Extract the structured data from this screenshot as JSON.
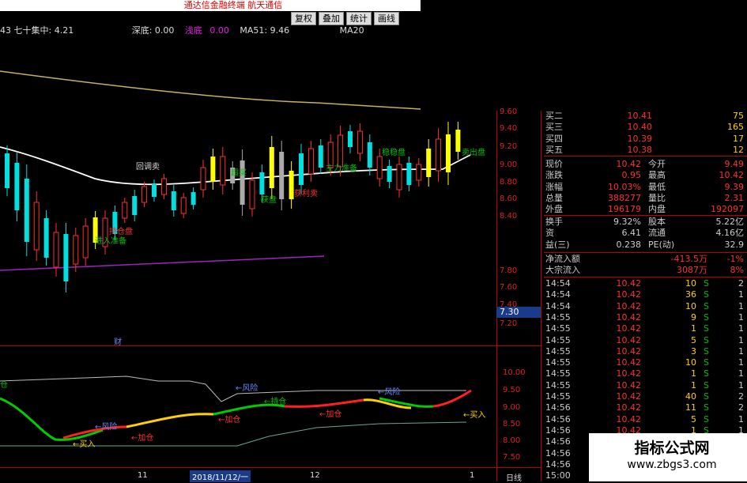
{
  "window": {
    "title": "通达信金融终端 航天通信"
  },
  "toolbar": {
    "buttons": [
      "复权",
      "叠加",
      "统计",
      "画线"
    ]
  },
  "infobar": {
    "part1": "43 七十集中: 4.21",
    "part2": "深底: 0.00",
    "part3": "浅底",
    "part4": "0.00",
    "part5": "MA51: 9.46",
    "part6": "MA20"
  },
  "price_axis": [
    "9.60",
    "9.40",
    "9.20",
    "9.00",
    "8.80",
    "8.60",
    "8.40",
    "7.80",
    "7.60",
    "7.40",
    "7.20"
  ],
  "current_price_tag": "7.30",
  "indicator_axis": [
    "10.00",
    "9.50",
    "9.00",
    "8.50",
    "8.00",
    "7.50"
  ],
  "chart_labels": {
    "pullback": "回调卖",
    "finance": "财",
    "mid1": "超买",
    "mid2": "获盘",
    "mid3": "主力准备",
    "sell": "获利卖",
    "buyzone": "稳稳盘",
    "retreat": "进入准备",
    "hold": "持仓盘",
    "risk_label": "卖出盘",
    "lbl_left": "仓"
  },
  "indicator_labels": {
    "risk1": "←风险",
    "risk2": "←风险",
    "risk3": "←风险",
    "buy1": "←买入",
    "buy2": "←买入",
    "add1": "←加仓",
    "add2": "←加仓",
    "add3": "←加仓",
    "hold1": "←持仓"
  },
  "x_axis": {
    "d1": "11",
    "date": "2018/11/12/一",
    "d2": "12",
    "d3": "1",
    "mode": "日线"
  },
  "quote_panel": {
    "asks": [
      {
        "label": "买二",
        "price": "10.41",
        "vol": "75"
      },
      {
        "label": "买三",
        "price": "10.40",
        "vol": "165"
      },
      {
        "label": "买四",
        "price": "10.39",
        "vol": "17"
      },
      {
        "label": "买五",
        "price": "10.38",
        "vol": "12"
      }
    ],
    "stats": [
      {
        "k1": "现价",
        "v1": "10.42",
        "k2": "今开",
        "v2": "9.49"
      },
      {
        "k1": "涨跌",
        "v1": "0.95",
        "k2": "最高",
        "v2": "10.42"
      },
      {
        "k1": "涨幅",
        "v1": "10.03%",
        "k2": "最低",
        "v2": "9.39"
      },
      {
        "k1": "总量",
        "v1": "388277",
        "k2": "量比",
        "v2": "2.31"
      },
      {
        "k1": "外盘",
        "v1": "196179",
        "k2": "内盘",
        "v2": "192097"
      }
    ],
    "stats2": [
      {
        "k1": "换手",
        "v1": "9.32%",
        "k2": "股本",
        "v2": "5.22亿"
      },
      {
        "k1": "资",
        "v1": "6.41",
        "k2": "流通",
        "v2": "4.16亿"
      },
      {
        "k1": "益(三)",
        "v1": "0.238",
        "k2": "PE(动)",
        "v2": "32.9"
      }
    ],
    "flow": [
      {
        "k": "净流入额",
        "v1": "-413.5万",
        "v2": "-1%"
      },
      {
        "k": "大宗流入",
        "v1": "3087万",
        "v2": "8%"
      }
    ],
    "ticks": [
      {
        "t": "14:54",
        "p": "10.42",
        "v": "10",
        "s": "S",
        "n": "2"
      },
      {
        "t": "14:54",
        "p": "10.42",
        "v": "36",
        "s": "S",
        "n": "1"
      },
      {
        "t": "14:54",
        "p": "10.42",
        "v": "10",
        "s": "S",
        "n": "1"
      },
      {
        "t": "14:55",
        "p": "10.42",
        "v": "9",
        "s": "S",
        "n": "1"
      },
      {
        "t": "14:55",
        "p": "10.42",
        "v": "1",
        "s": "S",
        "n": "1"
      },
      {
        "t": "14:55",
        "p": "10.42",
        "v": "5",
        "s": "S",
        "n": "1"
      },
      {
        "t": "14:55",
        "p": "10.42",
        "v": "3",
        "s": "S",
        "n": "1"
      },
      {
        "t": "14:55",
        "p": "10.42",
        "v": "10",
        "s": "S",
        "n": "1"
      },
      {
        "t": "14:55",
        "p": "10.42",
        "v": "1",
        "s": "S",
        "n": "1"
      },
      {
        "t": "14:55",
        "p": "10.42",
        "v": "1",
        "s": "S",
        "n": "1"
      },
      {
        "t": "14:55",
        "p": "10.42",
        "v": "40",
        "s": "S",
        "n": "2"
      },
      {
        "t": "14:56",
        "p": "10.42",
        "v": "11",
        "s": "S",
        "n": "2"
      },
      {
        "t": "14:56",
        "p": "10.42",
        "v": "5",
        "s": "S",
        "n": "1"
      },
      {
        "t": "14:56",
        "p": "10.42",
        "v": "1",
        "s": "S",
        "n": "1"
      },
      {
        "t": "14:56",
        "p": "10.42",
        "v": "",
        "s": "",
        "n": ""
      },
      {
        "t": "14:56",
        "p": "10.42",
        "v": "",
        "s": "",
        "n": ""
      },
      {
        "t": "14:56",
        "p": "",
        "v": "",
        "s": "",
        "n": ""
      },
      {
        "t": "15:00",
        "p": "",
        "v": "",
        "s": "",
        "n": ""
      }
    ]
  },
  "watermark": {
    "title": "指标公式网",
    "url": "www.zbgs3.com"
  },
  "colors": {
    "up": "#ff3030",
    "down": "#00e0e0",
    "yellow": "#ffff00",
    "grid": "#b00000",
    "ma": "#ffffff",
    "ma_long": "#c8b060",
    "purple": "#a020c0"
  }
}
